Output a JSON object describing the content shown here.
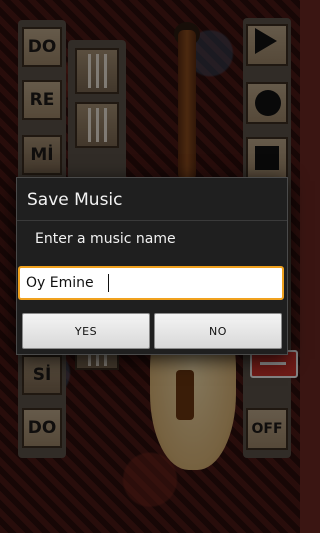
{
  "dialog": {
    "title": "Save Music",
    "message": "Enter a music name",
    "input_value": "Oy Emine",
    "yes_label": "YES",
    "no_label": "NO"
  },
  "notes": [
    "DO",
    "RE",
    "Mİ",
    "Sİ",
    "DO"
  ],
  "controls": {
    "off_label": "OFF",
    "icons": [
      "play-icon",
      "record-icon",
      "stop-icon",
      "back-arrow-icon"
    ]
  },
  "colors": {
    "input_focus": "#f0a11e",
    "dialog_bg": "#1f1f1f",
    "red_button": "#c8322a"
  }
}
